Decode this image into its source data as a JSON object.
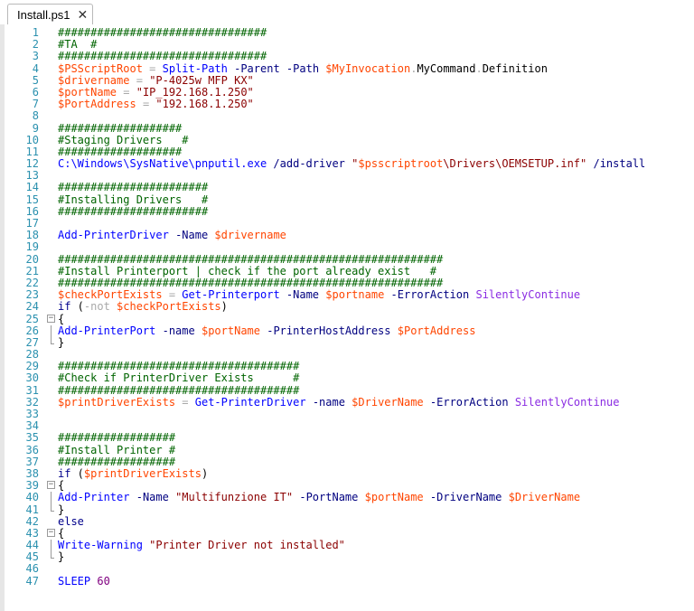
{
  "tab": {
    "title": "Install.ps1",
    "close_glyph": "✕"
  },
  "lines": [
    {
      "n": "1",
      "fold": "",
      "segs": [
        {
          "t": "c-comment",
          "v": "################################"
        }
      ]
    },
    {
      "n": "2",
      "fold": "",
      "segs": [
        {
          "t": "c-comment",
          "v": "#TA  #"
        }
      ]
    },
    {
      "n": "3",
      "fold": "",
      "segs": [
        {
          "t": "c-comment",
          "v": "################################"
        }
      ]
    },
    {
      "n": "4",
      "fold": "",
      "segs": [
        {
          "t": "c-var",
          "v": "$PSScriptRoot"
        },
        {
          "t": "c-plain",
          "v": " "
        },
        {
          "t": "c-op",
          "v": "="
        },
        {
          "t": "c-plain",
          "v": " "
        },
        {
          "t": "c-cmd",
          "v": "Split-Path"
        },
        {
          "t": "c-plain",
          "v": " "
        },
        {
          "t": "c-param",
          "v": "-Parent"
        },
        {
          "t": "c-plain",
          "v": " "
        },
        {
          "t": "c-param",
          "v": "-Path"
        },
        {
          "t": "c-plain",
          "v": " "
        },
        {
          "t": "c-var",
          "v": "$MyInvocation"
        },
        {
          "t": "c-op",
          "v": "."
        },
        {
          "t": "c-member",
          "v": "MyCommand"
        },
        {
          "t": "c-op",
          "v": "."
        },
        {
          "t": "c-member",
          "v": "Definition"
        }
      ]
    },
    {
      "n": "5",
      "fold": "",
      "segs": [
        {
          "t": "c-var",
          "v": "$drivername"
        },
        {
          "t": "c-plain",
          "v": " "
        },
        {
          "t": "c-op",
          "v": "="
        },
        {
          "t": "c-plain",
          "v": " "
        },
        {
          "t": "c-str",
          "v": "\"P-4025w MFP KX\""
        }
      ]
    },
    {
      "n": "6",
      "fold": "",
      "segs": [
        {
          "t": "c-var",
          "v": "$portName"
        },
        {
          "t": "c-plain",
          "v": " "
        },
        {
          "t": "c-op",
          "v": "="
        },
        {
          "t": "c-plain",
          "v": " "
        },
        {
          "t": "c-str",
          "v": "\"IP_192.168.1.250\""
        }
      ]
    },
    {
      "n": "7",
      "fold": "",
      "segs": [
        {
          "t": "c-var",
          "v": "$PortAddress"
        },
        {
          "t": "c-plain",
          "v": " "
        },
        {
          "t": "c-op",
          "v": "="
        },
        {
          "t": "c-plain",
          "v": " "
        },
        {
          "t": "c-str",
          "v": "\"192.168.1.250\""
        }
      ]
    },
    {
      "n": "8",
      "fold": "",
      "segs": []
    },
    {
      "n": "9",
      "fold": "",
      "segs": [
        {
          "t": "c-comment",
          "v": "###################"
        }
      ]
    },
    {
      "n": "10",
      "fold": "",
      "segs": [
        {
          "t": "c-comment",
          "v": "#Staging Drivers   #"
        }
      ]
    },
    {
      "n": "11",
      "fold": "",
      "segs": [
        {
          "t": "c-comment",
          "v": "###################"
        }
      ]
    },
    {
      "n": "12",
      "fold": "",
      "segs": [
        {
          "t": "c-cmd",
          "v": "C:\\Windows\\SysNative\\pnputil.exe"
        },
        {
          "t": "c-plain",
          "v": " "
        },
        {
          "t": "c-param",
          "v": "/add-driver"
        },
        {
          "t": "c-plain",
          "v": " "
        },
        {
          "t": "c-str",
          "v": "\""
        },
        {
          "t": "c-var",
          "v": "$psscriptroot"
        },
        {
          "t": "c-str",
          "v": "\\Drivers\\OEMSETUP.inf\""
        },
        {
          "t": "c-plain",
          "v": " "
        },
        {
          "t": "c-param",
          "v": "/install"
        }
      ]
    },
    {
      "n": "13",
      "fold": "",
      "segs": []
    },
    {
      "n": "14",
      "fold": "",
      "segs": [
        {
          "t": "c-comment",
          "v": "#######################"
        }
      ]
    },
    {
      "n": "15",
      "fold": "",
      "segs": [
        {
          "t": "c-comment",
          "v": "#Installing Drivers   #"
        }
      ]
    },
    {
      "n": "16",
      "fold": "",
      "segs": [
        {
          "t": "c-comment",
          "v": "#######################"
        }
      ]
    },
    {
      "n": "17",
      "fold": "",
      "segs": []
    },
    {
      "n": "18",
      "fold": "",
      "segs": [
        {
          "t": "c-cmd",
          "v": "Add-PrinterDriver"
        },
        {
          "t": "c-plain",
          "v": " "
        },
        {
          "t": "c-param",
          "v": "-Name"
        },
        {
          "t": "c-plain",
          "v": " "
        },
        {
          "t": "c-var",
          "v": "$drivername"
        }
      ]
    },
    {
      "n": "19",
      "fold": "",
      "segs": []
    },
    {
      "n": "20",
      "fold": "",
      "segs": [
        {
          "t": "c-comment",
          "v": "###########################################################"
        }
      ]
    },
    {
      "n": "21",
      "fold": "",
      "segs": [
        {
          "t": "c-comment",
          "v": "#Install Printerport | check if the port already exist   #"
        }
      ]
    },
    {
      "n": "22",
      "fold": "",
      "segs": [
        {
          "t": "c-comment",
          "v": "###########################################################"
        }
      ]
    },
    {
      "n": "23",
      "fold": "",
      "segs": [
        {
          "t": "c-var",
          "v": "$checkPortExists"
        },
        {
          "t": "c-plain",
          "v": " "
        },
        {
          "t": "c-op",
          "v": "="
        },
        {
          "t": "c-plain",
          "v": " "
        },
        {
          "t": "c-cmd",
          "v": "Get-Printerport"
        },
        {
          "t": "c-plain",
          "v": " "
        },
        {
          "t": "c-param",
          "v": "-Name"
        },
        {
          "t": "c-plain",
          "v": " "
        },
        {
          "t": "c-var",
          "v": "$portname"
        },
        {
          "t": "c-plain",
          "v": " "
        },
        {
          "t": "c-param",
          "v": "-ErrorAction"
        },
        {
          "t": "c-plain",
          "v": " "
        },
        {
          "t": "c-type",
          "v": "SilentlyContinue"
        }
      ]
    },
    {
      "n": "24",
      "fold": "",
      "segs": [
        {
          "t": "c-kw",
          "v": "if"
        },
        {
          "t": "c-plain",
          "v": " ("
        },
        {
          "t": "c-op",
          "v": "-not"
        },
        {
          "t": "c-plain",
          "v": " "
        },
        {
          "t": "c-var",
          "v": "$checkPortExists"
        },
        {
          "t": "c-plain",
          "v": ")"
        }
      ]
    },
    {
      "n": "25",
      "fold": "minus",
      "segs": [
        {
          "t": "c-plain",
          "v": "{"
        }
      ]
    },
    {
      "n": "26",
      "fold": "bar",
      "segs": [
        {
          "t": "c-cmd",
          "v": "Add-PrinterPort"
        },
        {
          "t": "c-plain",
          "v": " "
        },
        {
          "t": "c-param",
          "v": "-name"
        },
        {
          "t": "c-plain",
          "v": " "
        },
        {
          "t": "c-var",
          "v": "$portName"
        },
        {
          "t": "c-plain",
          "v": " "
        },
        {
          "t": "c-param",
          "v": "-PrinterHostAddress"
        },
        {
          "t": "c-plain",
          "v": " "
        },
        {
          "t": "c-var",
          "v": "$PortAddress"
        }
      ]
    },
    {
      "n": "27",
      "fold": "end",
      "segs": [
        {
          "t": "c-plain",
          "v": "}"
        }
      ]
    },
    {
      "n": "28",
      "fold": "",
      "segs": []
    },
    {
      "n": "29",
      "fold": "",
      "segs": [
        {
          "t": "c-comment",
          "v": "#####################################"
        }
      ]
    },
    {
      "n": "30",
      "fold": "",
      "segs": [
        {
          "t": "c-comment",
          "v": "#Check if PrinterDriver Exists      #"
        }
      ]
    },
    {
      "n": "31",
      "fold": "",
      "segs": [
        {
          "t": "c-comment",
          "v": "#####################################"
        }
      ]
    },
    {
      "n": "32",
      "fold": "",
      "segs": [
        {
          "t": "c-var",
          "v": "$printDriverExists"
        },
        {
          "t": "c-plain",
          "v": " "
        },
        {
          "t": "c-op",
          "v": "="
        },
        {
          "t": "c-plain",
          "v": " "
        },
        {
          "t": "c-cmd",
          "v": "Get-PrinterDriver"
        },
        {
          "t": "c-plain",
          "v": " "
        },
        {
          "t": "c-param",
          "v": "-name"
        },
        {
          "t": "c-plain",
          "v": " "
        },
        {
          "t": "c-var",
          "v": "$DriverName"
        },
        {
          "t": "c-plain",
          "v": " "
        },
        {
          "t": "c-param",
          "v": "-ErrorAction"
        },
        {
          "t": "c-plain",
          "v": " "
        },
        {
          "t": "c-type",
          "v": "SilentlyContinue"
        }
      ]
    },
    {
      "n": "33",
      "fold": "",
      "segs": []
    },
    {
      "n": "34",
      "fold": "",
      "segs": []
    },
    {
      "n": "35",
      "fold": "",
      "segs": [
        {
          "t": "c-comment",
          "v": "##################"
        }
      ]
    },
    {
      "n": "36",
      "fold": "",
      "segs": [
        {
          "t": "c-comment",
          "v": "#Install Printer #"
        }
      ]
    },
    {
      "n": "37",
      "fold": "",
      "segs": [
        {
          "t": "c-comment",
          "v": "##################"
        }
      ]
    },
    {
      "n": "38",
      "fold": "",
      "segs": [
        {
          "t": "c-kw",
          "v": "if"
        },
        {
          "t": "c-plain",
          "v": " ("
        },
        {
          "t": "c-var",
          "v": "$printDriverExists"
        },
        {
          "t": "c-plain",
          "v": ")"
        }
      ]
    },
    {
      "n": "39",
      "fold": "minus",
      "segs": [
        {
          "t": "c-plain",
          "v": "{"
        }
      ]
    },
    {
      "n": "40",
      "fold": "bar",
      "segs": [
        {
          "t": "c-cmd",
          "v": "Add-Printer"
        },
        {
          "t": "c-plain",
          "v": " "
        },
        {
          "t": "c-param",
          "v": "-Name"
        },
        {
          "t": "c-plain",
          "v": " "
        },
        {
          "t": "c-str",
          "v": "\"Multifunzione IT\""
        },
        {
          "t": "c-plain",
          "v": " "
        },
        {
          "t": "c-param",
          "v": "-PortName"
        },
        {
          "t": "c-plain",
          "v": " "
        },
        {
          "t": "c-var",
          "v": "$portName"
        },
        {
          "t": "c-plain",
          "v": " "
        },
        {
          "t": "c-param",
          "v": "-DriverName"
        },
        {
          "t": "c-plain",
          "v": " "
        },
        {
          "t": "c-var",
          "v": "$DriverName"
        }
      ]
    },
    {
      "n": "41",
      "fold": "end",
      "segs": [
        {
          "t": "c-plain",
          "v": "}"
        }
      ]
    },
    {
      "n": "42",
      "fold": "",
      "segs": [
        {
          "t": "c-kw",
          "v": "else"
        }
      ]
    },
    {
      "n": "43",
      "fold": "minus",
      "segs": [
        {
          "t": "c-plain",
          "v": "{"
        }
      ]
    },
    {
      "n": "44",
      "fold": "bar",
      "segs": [
        {
          "t": "c-cmd",
          "v": "Write-Warning"
        },
        {
          "t": "c-plain",
          "v": " "
        },
        {
          "t": "c-str",
          "v": "\"Printer Driver not installed\""
        }
      ]
    },
    {
      "n": "45",
      "fold": "end",
      "segs": [
        {
          "t": "c-plain",
          "v": "}"
        }
      ]
    },
    {
      "n": "46",
      "fold": "",
      "segs": []
    },
    {
      "n": "47",
      "fold": "",
      "segs": [
        {
          "t": "c-cmd",
          "v": "SLEEP"
        },
        {
          "t": "c-plain",
          "v": " "
        },
        {
          "t": "c-num",
          "v": "60"
        }
      ]
    }
  ]
}
